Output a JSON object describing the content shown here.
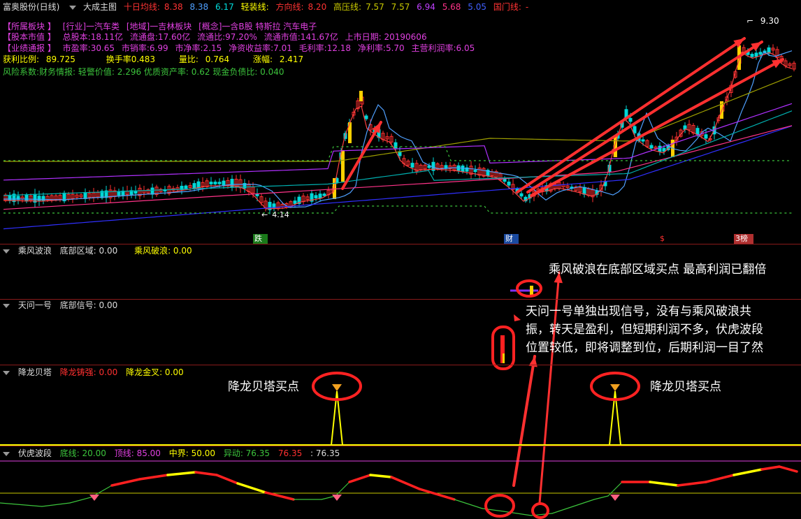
{
  "header": {
    "stock": "富奥股份(日线)",
    "main_indicator": "大成主图",
    "ma10_label": "十日均线:",
    "ma10_v1": "8.38",
    "ma10_v2": "8.38",
    "ma10_v3": "6.17",
    "light_label": "轻装线:",
    "dir_label": "方向线:",
    "dir_v": "8.20",
    "press_label": "高压线:",
    "press_v1": "7.57",
    "press_v2": "7.57",
    "v4": "6.94",
    "v5": "5.68",
    "v6": "5.05",
    "gate_label": "国门线:",
    "gate_v": "-"
  },
  "info": {
    "sector": "【所属板块 】",
    "industry": "[行业]一汽车类",
    "region": "[地域]一吉林板块",
    "concept": "[概念]一含B股 特斯拉 汽车电子",
    "mcap_tag": "【股本市值 】",
    "total_shares": "总股本:18.11亿",
    "float_shares": "流通盘:17.60亿",
    "float_ratio": "流通比:97.20%",
    "float_mcap": "流通市值:141.67亿",
    "list_date": "上市日期: 20190606",
    "perf_tag": "【业绩通报 】",
    "pe": "市盈率:30.65",
    "ps": "市销率:6.99",
    "pb": "市净率:2.15",
    "roe": "净资收益率:7.01",
    "gross_margin": "毛利率:12.18",
    "net_margin": "净利率:5.70",
    "main_margin": "主营利润率:6.05",
    "profit_ratio": "获利比例:",
    "profit_ratio_v": "89.725",
    "turnover": "换手率0.483",
    "vol_ratio": "量比:",
    "vol_ratio_v": "0.764",
    "change": "涨幅:",
    "change_v": "2.417",
    "risk": "风险系数:财务情报: 轻警价值: 2.296 优质资产率: 0.62 现金负债比: 0.040"
  },
  "chart_labels": {
    "high_price": "9.30",
    "low_price": "4.14",
    "marker_fall": "跌",
    "marker_fin": "财",
    "marker_s": "$",
    "marker_top": "3榜"
  },
  "panel1": {
    "name": "乘风波浪",
    "f1": "底部区域: 0.00",
    "f2": "乘风破浪: 0.00"
  },
  "panel2": {
    "name": "天问一号",
    "f1": "底部信号: 0.00"
  },
  "panel3": {
    "name": "降龙贝塔",
    "f1": "降龙铸强: 0.00",
    "f2": "降龙金叉: 0.00"
  },
  "panel4": {
    "name": "伏虎波段",
    "f1": "底线: 20.00",
    "f2": "顶线: 85.00",
    "f3": "中界: 50.00",
    "f4": "异动: 76.35",
    "f5": "76.35",
    "f6": ": 76.35"
  },
  "annotations": {
    "a1": "乘风破浪在底部区域买点 最高利润已翻倍",
    "a2_l1": "天问一号单独出现信号，没有与乘风破浪共",
    "a2_l2": "振，转天是盈利，但短期利润不多，伏虎波段",
    "a2_l3": "位置较低，即将调整到位，后期利润一目了然",
    "a3": "降龙贝塔买点",
    "a4": "降龙贝塔买点"
  },
  "colors": {
    "up": "#ff3030",
    "down": "#00e0e0",
    "signal": "#ffff00",
    "accent": "#ff2222"
  }
}
